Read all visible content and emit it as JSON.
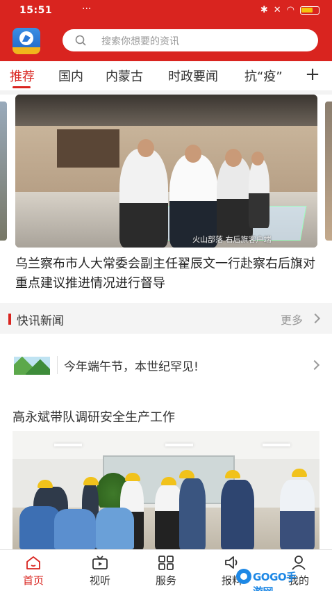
{
  "status_bar": {
    "time": "15:51",
    "dots": "···"
  },
  "search": {
    "placeholder": "搜索你想要的资讯"
  },
  "tabs": [
    {
      "label": "推荐",
      "active": true
    },
    {
      "label": "国内",
      "active": false
    },
    {
      "label": "内蒙古",
      "active": false
    },
    {
      "label": "时政要闻",
      "active": false
    },
    {
      "label": "抗“疫”",
      "active": false
    }
  ],
  "add_tab": "+",
  "hero": {
    "watermark": "火山部落 右后旗客户端",
    "headline": "乌兰察布市人大常委会副主任翟辰文一行赴察右后旗对重点建议推进情况进行督导"
  },
  "flash": {
    "title": "快讯新闻",
    "more": "更多"
  },
  "news_item": {
    "text": "今年端午节，本世纪罕见!"
  },
  "article": {
    "title": "高永斌带队调研安全生产工作"
  },
  "bottom_nav": [
    {
      "label": "首页",
      "icon": "home-icon",
      "active": true
    },
    {
      "label": "视听",
      "icon": "tv-icon",
      "active": false
    },
    {
      "label": "服务",
      "icon": "grid-icon",
      "active": false
    },
    {
      "label": "报料",
      "icon": "speaker-icon",
      "active": false
    },
    {
      "label": "我的",
      "icon": "user-icon",
      "active": false
    }
  ],
  "watermark_badge": {
    "text": "GOGO手游网"
  },
  "colors": {
    "brand_red": "#d9241f",
    "background": "#ffffff",
    "muted_text": "#999999"
  }
}
